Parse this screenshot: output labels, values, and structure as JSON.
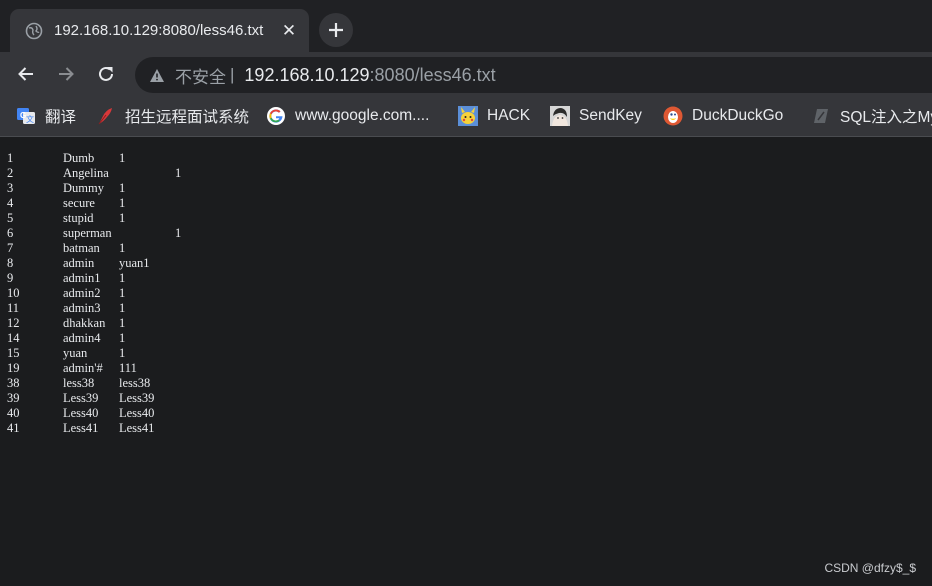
{
  "tab": {
    "title": "192.168.10.129:8080/less46.txt",
    "close_glyph": "✕",
    "favicon": "globe-icon"
  },
  "newtab_glyph": "+",
  "toolbar": {
    "back_icon": "arrow-left-icon",
    "forward_icon": "arrow-right-icon",
    "reload_icon": "reload-icon"
  },
  "address": {
    "security_label": "不安全",
    "separator": "|",
    "host": "192.168.10.129",
    "rest": ":8080/less46.txt"
  },
  "bookmarks": [
    {
      "label": "翻译",
      "icon": "google-translate-icon"
    },
    {
      "label": "招生远程面试系统",
      "icon": "red-feather-icon"
    },
    {
      "label": "www.google.com....",
      "icon": "google-g-icon"
    },
    {
      "label": "HACK",
      "icon": "pikachu-icon"
    },
    {
      "label": "SendKey",
      "icon": "anime-avatar-icon"
    },
    {
      "label": "DuckDuckGo",
      "icon": "duckduckgo-icon"
    },
    {
      "label": "SQL注入之My",
      "icon": "document-icon"
    }
  ],
  "rows": [
    {
      "id": "1",
      "user": "Dumb",
      "pass": "1",
      "wide": false
    },
    {
      "id": "2",
      "user": "Angelina",
      "pass": "1",
      "wide": true
    },
    {
      "id": "3",
      "user": "Dummy",
      "pass": "1",
      "wide": false
    },
    {
      "id": "4",
      "user": "secure",
      "pass": "1",
      "wide": false
    },
    {
      "id": "5",
      "user": "stupid",
      "pass": "1",
      "wide": false
    },
    {
      "id": "6",
      "user": "superman",
      "pass": "1",
      "wide": true
    },
    {
      "id": "7",
      "user": "batman",
      "pass": "1",
      "wide": false
    },
    {
      "id": "8",
      "user": "admin",
      "pass": "yuan1",
      "wide": false
    },
    {
      "id": "9",
      "user": "admin1",
      "pass": "1",
      "wide": false
    },
    {
      "id": "10",
      "user": "admin2",
      "pass": "1",
      "wide": false
    },
    {
      "id": "11",
      "user": "admin3",
      "pass": "1",
      "wide": false
    },
    {
      "id": "12",
      "user": "dhakkan",
      "pass": "1",
      "wide": false
    },
    {
      "id": "14",
      "user": "admin4",
      "pass": "1",
      "wide": false
    },
    {
      "id": "15",
      "user": "yuan",
      "pass": "1",
      "wide": false
    },
    {
      "id": "19",
      "user": "admin'#",
      "pass": "111",
      "wide": false
    },
    {
      "id": "38",
      "user": "less38",
      "pass": "less38",
      "wide": false
    },
    {
      "id": "39",
      "user": "Less39",
      "pass": "Less39",
      "wide": false
    },
    {
      "id": "40",
      "user": "Less40",
      "pass": "Less40",
      "wide": false
    },
    {
      "id": "41",
      "user": "Less41",
      "pass": "Less41",
      "wide": false
    }
  ],
  "watermark": "CSDN @dfzy$_$",
  "colors": {
    "page_bg": "#1b1c1e",
    "chrome_bg": "#35363a",
    "tabstrip_bg": "#202124",
    "text": "#e8eaed",
    "muted": "#9aa0a6"
  }
}
